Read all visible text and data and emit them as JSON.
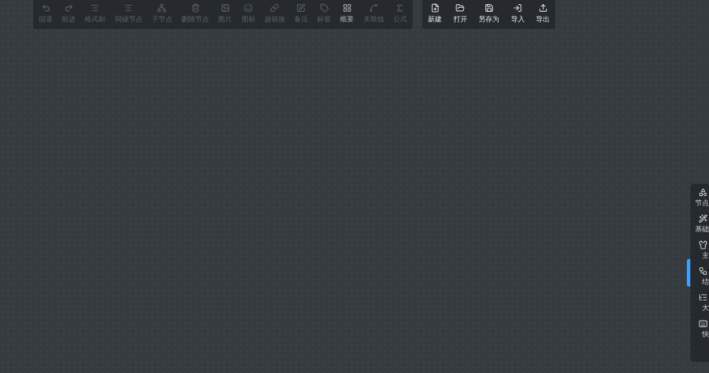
{
  "toolbar": {
    "items": [
      {
        "label": "回退",
        "disabled": true
      },
      {
        "label": "前进",
        "disabled": true
      },
      {
        "label": "格式刷",
        "disabled": true
      },
      {
        "label": "同级节点",
        "disabled": true
      },
      {
        "label": "子节点",
        "disabled": true
      },
      {
        "label": "删除节点",
        "disabled": true
      },
      {
        "label": "图片",
        "disabled": true
      },
      {
        "label": "图标",
        "disabled": true
      },
      {
        "label": "超链接",
        "disabled": true
      },
      {
        "label": "备注",
        "disabled": true
      },
      {
        "label": "标签",
        "disabled": true
      },
      {
        "label": "概要",
        "disabled": false
      },
      {
        "label": "关联线",
        "disabled": true
      },
      {
        "label": "公式",
        "disabled": true
      }
    ]
  },
  "file_toolbar": {
    "items": [
      {
        "label": "新建"
      },
      {
        "label": "打开"
      },
      {
        "label": "另存为"
      },
      {
        "label": "导入"
      },
      {
        "label": "导出"
      }
    ]
  },
  "sidebar": {
    "items": [
      {
        "label": "节点"
      },
      {
        "label": "基础"
      },
      {
        "label": "主"
      },
      {
        "label": "结"
      },
      {
        "label": "大"
      },
      {
        "label": "快"
      }
    ]
  }
}
